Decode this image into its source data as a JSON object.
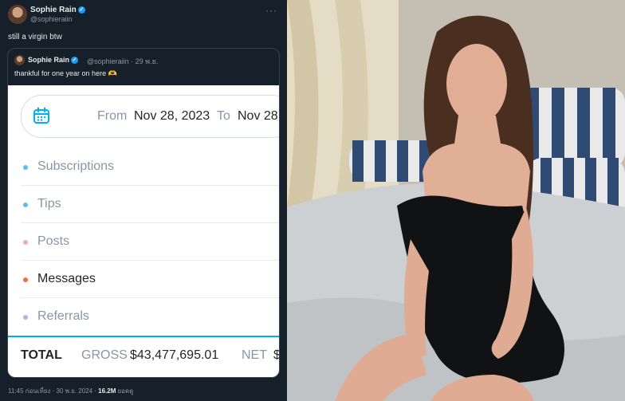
{
  "tweet": {
    "author_name": "Sophie Rain",
    "author_handle": "@sophieraiin",
    "more_icon": "more-horizontal-icon",
    "text": "still a virgin btw",
    "footer": {
      "time_date": "11:45 ก่อนเที่ยง · 30 พ.ย. 2024 · ",
      "views": "16.2M",
      "views_label": " ยอดดู"
    }
  },
  "quote": {
    "author_name": "Sophie Rain",
    "author_handle": "@sophieraiin",
    "meta": "@sophieraiin · 29 พ.ย.",
    "text": "thankful for one year on here 🫶"
  },
  "earnings": {
    "calendar_icon": "calendar-icon",
    "from_label": "From",
    "from_value": "Nov 28, 2023",
    "to_label": "To",
    "to_value": "Nov 28",
    "rows": [
      {
        "label": "Subscriptions",
        "dot_color": "#5bc0eb",
        "active": false
      },
      {
        "label": "Tips",
        "dot_color": "#5bc0eb",
        "active": false
      },
      {
        "label": "Posts",
        "dot_color": "#f3a6c3",
        "active": false
      },
      {
        "label": "Messages",
        "dot_color": "#f0703a",
        "active": true
      },
      {
        "label": "Referrals",
        "dot_color": "#c8a7e6",
        "active": false
      }
    ],
    "total_label": "TOTAL",
    "gross_label": "GROSS",
    "gross_value": "$43,477,695.01",
    "net_label": "NET",
    "net_value": "$"
  },
  "colors": {
    "background": "#15202b",
    "accent": "#1d9bf0",
    "onlyfans_blue": "#00aff0"
  }
}
